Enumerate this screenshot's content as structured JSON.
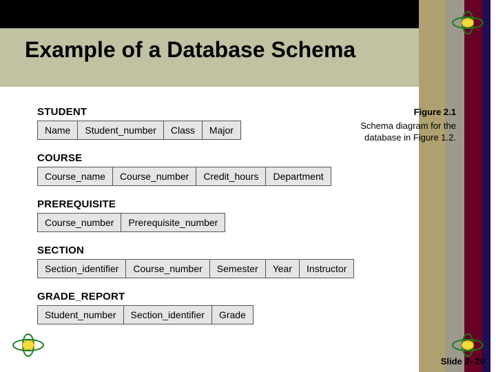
{
  "title": "Example of a Database Schema",
  "figure": {
    "number": "Figure 2.1",
    "caption": "Schema diagram for the database in Figure 1.2."
  },
  "schemas": [
    {
      "name": "STUDENT",
      "columns": [
        "Name",
        "Student_number",
        "Class",
        "Major"
      ]
    },
    {
      "name": "COURSE",
      "columns": [
        "Course_name",
        "Course_number",
        "Credit_hours",
        "Department"
      ]
    },
    {
      "name": "PREREQUISITE",
      "columns": [
        "Course_number",
        "Prerequisite_number"
      ]
    },
    {
      "name": "SECTION",
      "columns": [
        "Section_identifier",
        "Course_number",
        "Semester",
        "Year",
        "Instructor"
      ]
    },
    {
      "name": "GRADE_REPORT",
      "columns": [
        "Student_number",
        "Section_identifier",
        "Grade"
      ]
    }
  ],
  "slide_number": "Slide 2- 20"
}
